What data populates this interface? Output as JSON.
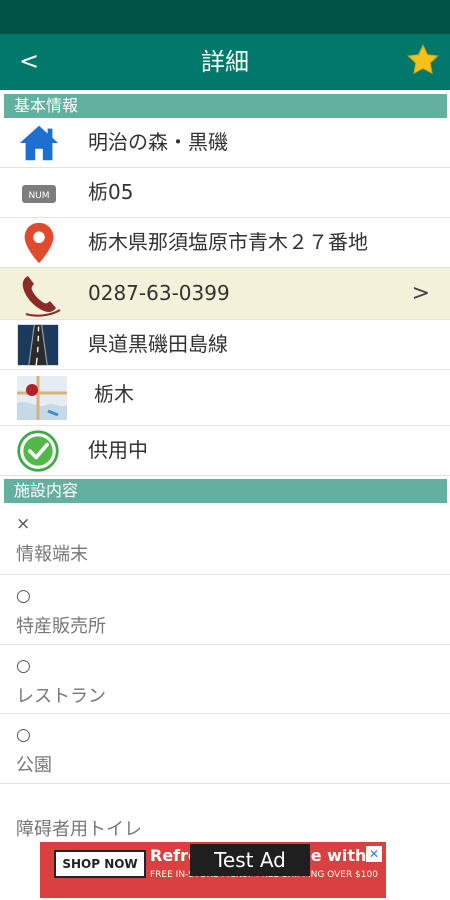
{
  "header": {
    "back_label": "<",
    "title": "詳細"
  },
  "sections": {
    "basic": "基本情報",
    "facilities": "施設内容"
  },
  "basic": {
    "name": "明治の森・黒磯",
    "number": "栃05",
    "number_badge": "NUM",
    "address": "栃木県那須塩原市青木２７番地",
    "phone": "0287-63-0399",
    "phone_chevron": ">",
    "road": "県道黒磯田島線",
    "prefecture": "栃木",
    "status": "供用中"
  },
  "facilities": [
    {
      "mark": "×",
      "label": "情報端末"
    },
    {
      "mark": "○",
      "label": "特産販売所"
    },
    {
      "mark": "○",
      "label": "レストラン"
    },
    {
      "mark": "○",
      "label": "公園"
    },
    {
      "mark": "",
      "label": "障碍者用トイレ"
    }
  ],
  "ad": {
    "shop_label": "SHOP NOW",
    "label": "Test Ad",
    "headline": "Refresh your home with c",
    "subline": "FREE IN-STORE PICKUP  FREE SHIPPING OVER $100",
    "close": "✕"
  },
  "colors": {
    "status_bar": "#005446",
    "app_bar": "#00796b",
    "section_header": "#63b0a1",
    "highlight_row": "#f3f1d9",
    "star": "#f6c21a"
  }
}
